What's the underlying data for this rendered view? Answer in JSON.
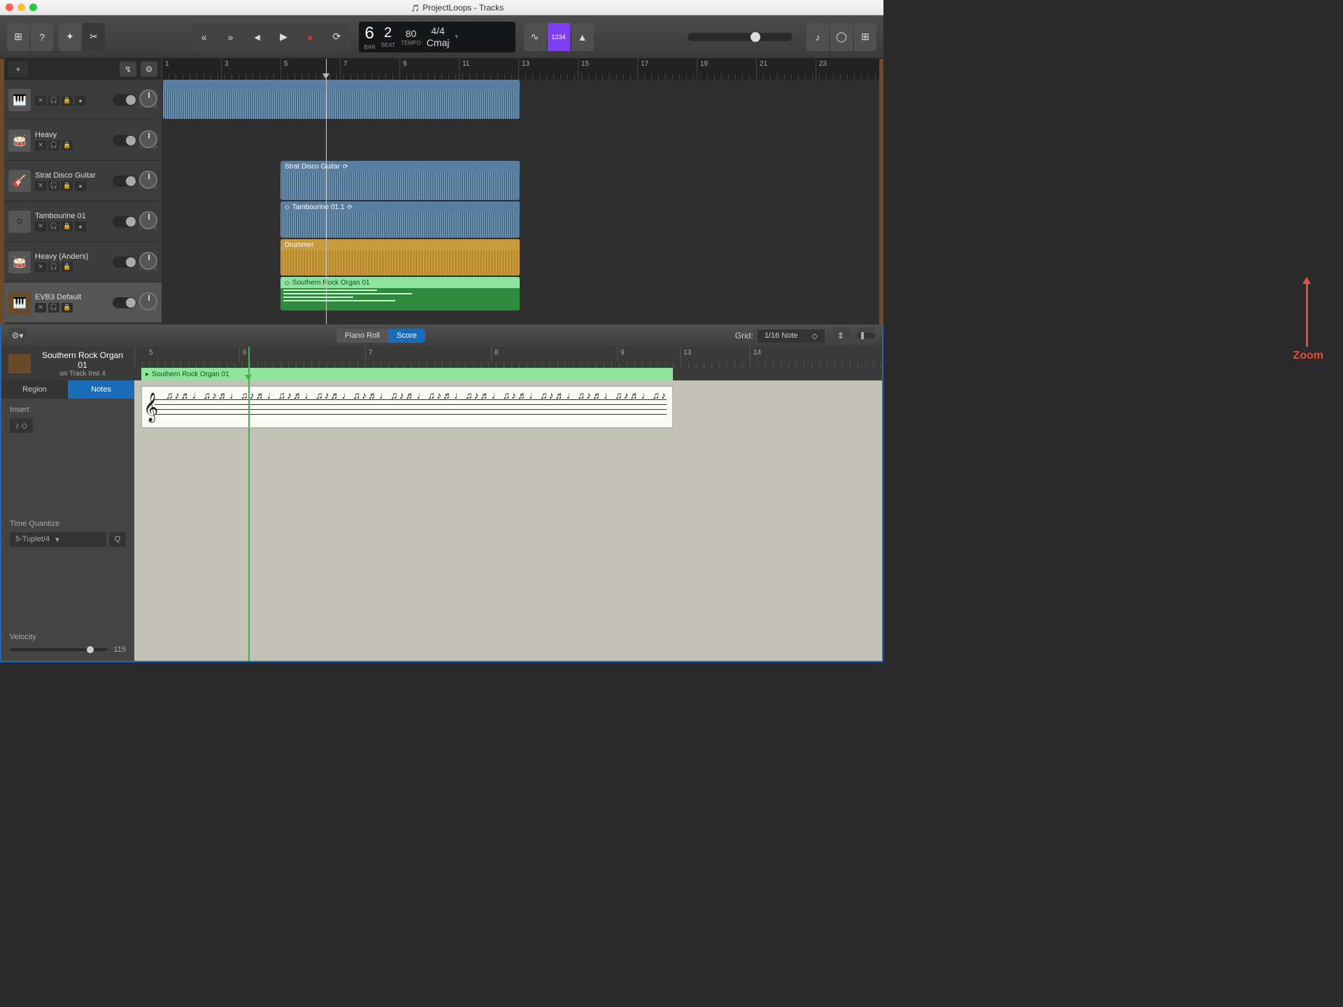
{
  "window": {
    "title": "ProjectLoops - Tracks"
  },
  "toolbar": {
    "library_icon": "⊞",
    "help_icon": "?",
    "smart_icon": "✦",
    "scissors_icon": "✂",
    "rewind": "«",
    "forward": "»",
    "prev": "◄",
    "play": "▶",
    "record": "●",
    "cycle": "⟳",
    "bar_label": "BAR",
    "bar_value": "6",
    "beat_label": "BEAT",
    "beat_value": "2",
    "tempo_label": "TEMPO",
    "tempo_value": "80",
    "sig_value": "4/4",
    "key_value": "Cmaj",
    "tuner_icon": "∿",
    "count_in": "1234",
    "metronome_icon": "▲",
    "note_icon": "♪",
    "loop_icon": "◯",
    "apps_icon": "⊞"
  },
  "trackheader": {
    "add": "+",
    "automation": "↯",
    "flex": "⚙"
  },
  "ruler_marks": [
    "1",
    "3",
    "5",
    "7",
    "9",
    "11",
    "13",
    "15",
    "17",
    "19",
    "21",
    "23"
  ],
  "tracks": [
    {
      "name": "",
      "icon": "🎹",
      "btns": [
        "✕",
        "🎧",
        "🔒",
        "●"
      ]
    },
    {
      "name": "Heavy",
      "icon": "🥁",
      "btns": [
        "✕",
        "🎧",
        "🔒"
      ]
    },
    {
      "name": "Strat Disco Guitar",
      "icon": "🎸",
      "btns": [
        "✕",
        "🎧",
        "🔒",
        "●"
      ]
    },
    {
      "name": "Tambourine 01",
      "icon": "○",
      "btns": [
        "✕",
        "🎧",
        "🔒",
        "●"
      ]
    },
    {
      "name": "Heavy (Anders)",
      "icon": "🥁",
      "btns": [
        "✕",
        "🎧",
        "🔒"
      ]
    },
    {
      "name": "EVB3 Default",
      "icon": "🎹",
      "btns": [
        "✕",
        "🎧",
        "🔒"
      ]
    }
  ],
  "regions": {
    "r1": {
      "name": ""
    },
    "r2": {
      "name": "Strat Disco Guitar",
      "loop": "⟳"
    },
    "r3": {
      "name": "Tambourine 01.1",
      "loop": "⟳",
      "loopmark": "◇"
    },
    "r4": {
      "name": "Drummer"
    },
    "r5": {
      "name": "Southern Rock Organ 01",
      "loopmark": "◇"
    }
  },
  "editor": {
    "tool_icon": "⚙▾",
    "tab_piano": "Piano Roll",
    "tab_score": "Score",
    "grid_label": "Grid:",
    "grid_value": "1/16 Note",
    "grid_chev": "◇",
    "vzoom_icon": "⇕",
    "side": {
      "title": "Southern Rock Organ 01",
      "subtitle": "on Track Inst 4",
      "tab_region": "Region",
      "tab_notes": "Notes",
      "insert_label": "Insert",
      "insert_value": "♪  ◇",
      "tq_label": "Time Quantize",
      "tq_value": "5-Tuplet/4",
      "tq_chev": "▾",
      "q_btn": "Q",
      "vel_label": "Velocity",
      "vel_value": "115"
    },
    "ruler_marks": [
      "5",
      "6",
      "7",
      "8",
      "9",
      "13",
      "14"
    ],
    "region_name": "Southern Rock Organ 01",
    "play_icon": "▸"
  },
  "annotation": {
    "zoom": "Zoom"
  }
}
